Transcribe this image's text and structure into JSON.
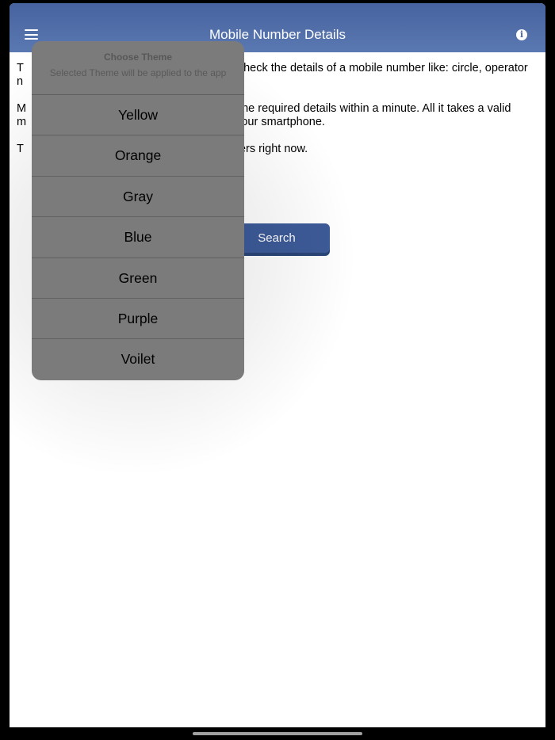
{
  "navbar": {
    "title": "Mobile Number Details",
    "menu_icon": "hamburger-menu-icon",
    "info_icon": "info-icon",
    "info_glyph": "i",
    "color": "#4d6aa8"
  },
  "content": {
    "paragraphs": [
      {
        "lead": "T",
        "text": "check the details of a mobile number like: circle, operator",
        "line2": "n"
      },
      {
        "lead": "M",
        "text": "the required details within a minute. All it takes a valid",
        "lead2": "m",
        "text2": "your smartphone."
      },
      {
        "lead": "T",
        "text": "bers right now."
      }
    ]
  },
  "search_button": {
    "label": "Search"
  },
  "theme_popup": {
    "title": "Choose Theme",
    "subtitle": "Selected Theme will be applied to the app",
    "options": [
      "Yellow",
      "Orange",
      "Gray",
      "Blue",
      "Green",
      "Purple",
      "Voilet"
    ]
  },
  "colors": {
    "accent": "#4d6aa8",
    "popup_bg": "#7b7b7b",
    "button": "#3d5b99"
  }
}
